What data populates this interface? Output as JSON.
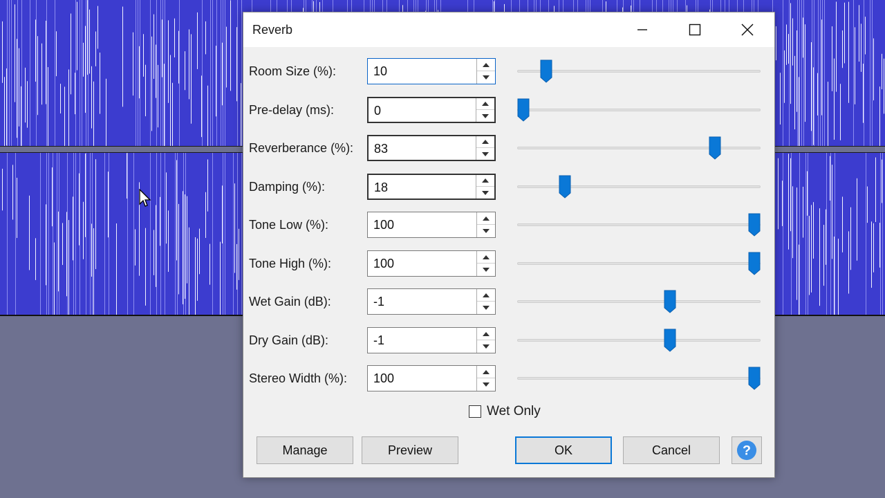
{
  "dialog": {
    "title": "Reverb",
    "controls": [
      {
        "label": "Room Size (%):",
        "value": "10",
        "min": 0,
        "max": 100,
        "level": 10
      },
      {
        "label": "Pre-delay (ms):",
        "value": "0",
        "min": 0,
        "max": 250,
        "level": 0
      },
      {
        "label": "Reverberance (%):",
        "value": "83",
        "min": 0,
        "max": 100,
        "level": 83
      },
      {
        "label": "Damping (%):",
        "value": "18",
        "min": 0,
        "max": 100,
        "level": 18
      },
      {
        "label": "Tone Low (%):",
        "value": "100",
        "min": 0,
        "max": 100,
        "level": 100
      },
      {
        "label": "Tone High (%):",
        "value": "100",
        "min": 0,
        "max": 100,
        "level": 100
      },
      {
        "label": "Wet Gain (dB):",
        "value": "-1",
        "min": -20,
        "max": 10,
        "level": -1
      },
      {
        "label": "Dry Gain (dB):",
        "value": "-1",
        "min": -20,
        "max": 10,
        "level": -1
      },
      {
        "label": "Stereo Width (%):",
        "value": "100",
        "min": 0,
        "max": 100,
        "level": 100
      }
    ],
    "wet_only": {
      "label": "Wet Only",
      "checked": false
    },
    "buttons": {
      "manage": "Manage",
      "preview": "Preview",
      "ok": "OK",
      "cancel": "Cancel",
      "help_icon": "help-icon"
    }
  },
  "colors": {
    "waveform": "#3c3ccf",
    "slider_thumb": "#0a78d7",
    "ok_border": "#0a78d7",
    "help_icon": "#3a8ee6"
  }
}
